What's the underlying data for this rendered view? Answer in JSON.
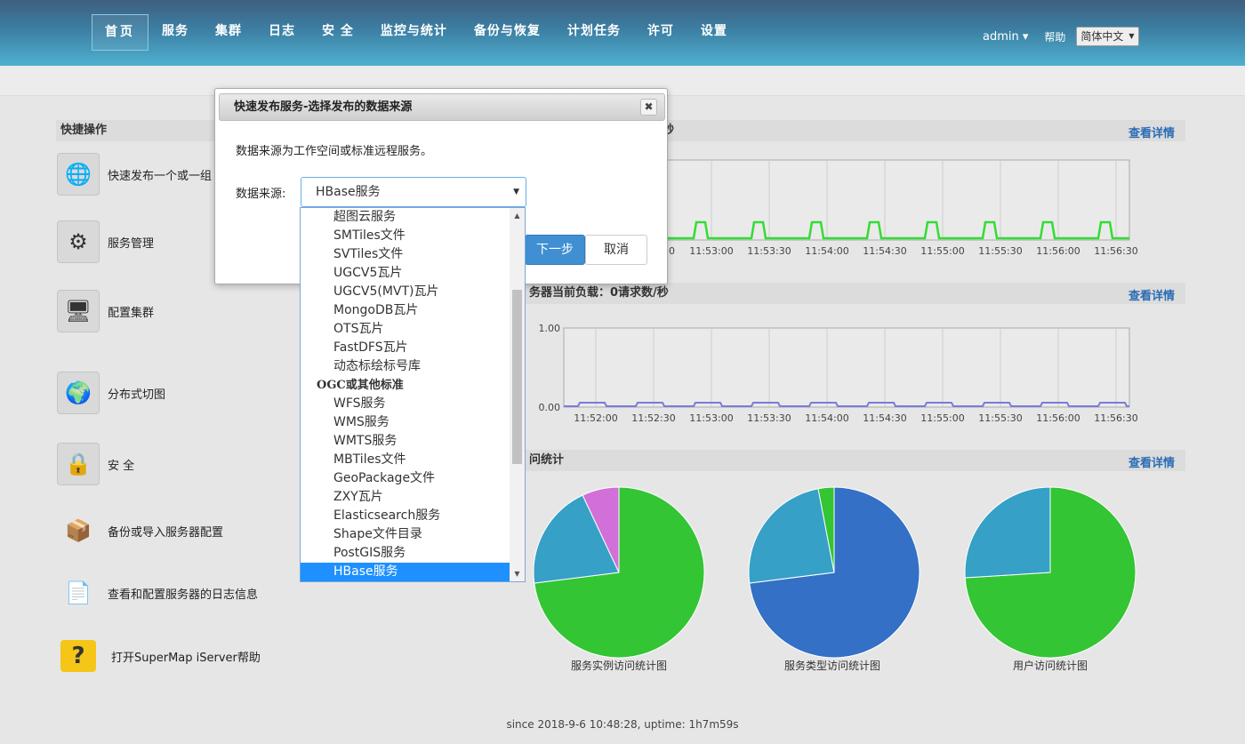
{
  "nav": {
    "items": [
      "首页",
      "服务",
      "集群",
      "日志",
      "安 全",
      "监控与统计",
      "备份与恢复",
      "计划任务",
      "许可",
      "设置"
    ],
    "active_index": 0,
    "user": "admin ▾",
    "help": "帮助",
    "language": "简体中文",
    "language_arrow": "▼"
  },
  "quick_ops": {
    "title": "快捷操作",
    "items": [
      {
        "label": "快速发布一个或一组",
        "icon": "globe-cursor-icon"
      },
      {
        "label": "服务管理",
        "icon": "gear-window-icon"
      },
      {
        "label": "配置集群",
        "icon": "computer-cluster-icon"
      },
      {
        "label": "分布式切图",
        "icon": "globe-grid-icon"
      },
      {
        "label": "安 全",
        "icon": "lock-icon"
      },
      {
        "label": "备份或导入服务器配置",
        "icon": "backup-icon"
      },
      {
        "label": "查看和配置服务器的日志信息",
        "icon": "log-document-icon"
      },
      {
        "label": "打开SuperMap iServer帮助",
        "icon": "help-folder-icon"
      }
    ]
  },
  "panels": {
    "top_title_fragment": "秒",
    "mid_title_fragment": "务器当前负载：0请求数/秒",
    "bottom_title_fragment": "问统计",
    "detail_link": "查看详情"
  },
  "chart_data": [
    {
      "type": "line",
      "title": "",
      "x": [
        "11:52:30",
        "11:53:00",
        "11:53:30",
        "11:54:00",
        "11:54:30",
        "11:55:00",
        "11:55:30",
        "11:56:00",
        "11:56:30"
      ],
      "x_first_label_fragment": "30",
      "series": [
        {
          "values": [
            0,
            1,
            1,
            1,
            1,
            1,
            1,
            1,
            1
          ]
        }
      ],
      "color": "#33dd33",
      "grid": true
    },
    {
      "type": "line",
      "title": "",
      "x": [
        "11:52:00",
        "11:52:30",
        "11:53:00",
        "11:53:30",
        "11:54:00",
        "11:54:30",
        "11:55:00",
        "11:55:30",
        "11:56:00",
        "11:56:30"
      ],
      "yticks": [
        "1.00",
        "0.00"
      ],
      "ylim": [
        0,
        1
      ],
      "series": [
        {
          "values": [
            0,
            0,
            0,
            0,
            0,
            0,
            0,
            0,
            0,
            0
          ]
        }
      ],
      "color": "#7b7bdb",
      "grid": true
    },
    {
      "type": "pie",
      "title": "服务实例访问统计图",
      "series": [
        {
          "values": [
            73,
            20,
            7
          ]
        }
      ],
      "colors": [
        "#33c533",
        "#36a0c6",
        "#d070d8"
      ]
    },
    {
      "type": "pie",
      "title": "服务类型访问统计图",
      "series": [
        {
          "values": [
            73,
            24,
            3
          ]
        }
      ],
      "colors": [
        "#3370c6",
        "#36a0c6",
        "#33c533"
      ]
    },
    {
      "type": "pie",
      "title": "用户访问统计图",
      "series": [
        {
          "values": [
            74,
            26
          ]
        }
      ],
      "colors": [
        "#33c533",
        "#36a0c6"
      ]
    }
  ],
  "footer": "since 2018-9-6 10:48:28, uptime: 1h7m59s",
  "dialog": {
    "title": "快速发布服务-选择发布的数据来源",
    "close": "✖",
    "description": "数据来源为工作空间或标准远程服务。",
    "source_label": "数据来源:",
    "selected_value": "HBase服务",
    "select_arrow": "▼",
    "next_button": "下一步",
    "cancel_button": "取消"
  },
  "dropdown": {
    "scroll_up": "▲",
    "scroll_down": "▼",
    "items": [
      {
        "label": "超图云服务",
        "group": false
      },
      {
        "label": "SMTiles文件",
        "group": false
      },
      {
        "label": "SVTiles文件",
        "group": false
      },
      {
        "label": "UGCV5瓦片",
        "group": false
      },
      {
        "label": "UGCV5(MVT)瓦片",
        "group": false
      },
      {
        "label": "MongoDB瓦片",
        "group": false
      },
      {
        "label": "OTS瓦片",
        "group": false
      },
      {
        "label": "FastDFS瓦片",
        "group": false
      },
      {
        "label": "动态标绘标号库",
        "group": false
      },
      {
        "label": "OGC或其他标准",
        "group": true
      },
      {
        "label": "WFS服务",
        "group": false
      },
      {
        "label": "WMS服务",
        "group": false
      },
      {
        "label": "WMTS服务",
        "group": false
      },
      {
        "label": "MBTiles文件",
        "group": false
      },
      {
        "label": "GeoPackage文件",
        "group": false
      },
      {
        "label": "ZXY瓦片",
        "group": false
      },
      {
        "label": "Elasticsearch服务",
        "group": false
      },
      {
        "label": "Shape文件目录",
        "group": false
      },
      {
        "label": "PostGIS服务",
        "group": false
      },
      {
        "label": "HBase服务",
        "group": false,
        "selected": true
      }
    ]
  }
}
